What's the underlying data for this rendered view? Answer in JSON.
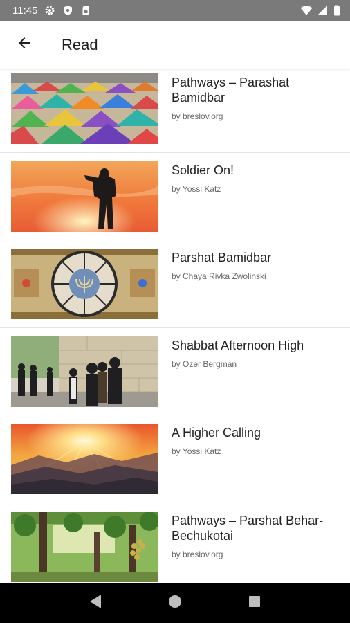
{
  "status_bar": {
    "time": "11:45",
    "icons": [
      "gear-icon",
      "shield-icon",
      "sim-card-icon",
      "wifi-icon",
      "signal-icon",
      "battery-icon"
    ]
  },
  "app_bar": {
    "back_icon": "arrow-left-icon",
    "title": "Read"
  },
  "articles": [
    {
      "title": "Pathways – Parashat Bamidbar",
      "author": "by breslov.org",
      "image": "colorful-tents-encampment"
    },
    {
      "title": "Soldier On!",
      "author": "by Yossi Katz",
      "image": "soldier-silhouette-sunset"
    },
    {
      "title": "Parshat Bamidbar",
      "author": "by Chaya Rivka Zwolinski",
      "image": "zodiac-mosaic-menorah"
    },
    {
      "title": "Shabbat Afternoon High",
      "author": "by Ozer Bergman",
      "image": "men-walking-stone-wall"
    },
    {
      "title": "A Higher Calling",
      "author": "by Yossi Katz",
      "image": "sunrise-over-mountains"
    },
    {
      "title": "Pathways – Parshat Behar-Bechukotai",
      "author": "by breslov.org",
      "image": "vineyard-grapes"
    }
  ],
  "nav_bar": {
    "icons": [
      "back-triangle-icon",
      "home-circle-icon",
      "recents-square-icon"
    ]
  },
  "colors": {
    "status_bar": "#7a7a7a",
    "nav_bar": "#000000",
    "title_text": "#222222",
    "author_text": "#666666"
  }
}
